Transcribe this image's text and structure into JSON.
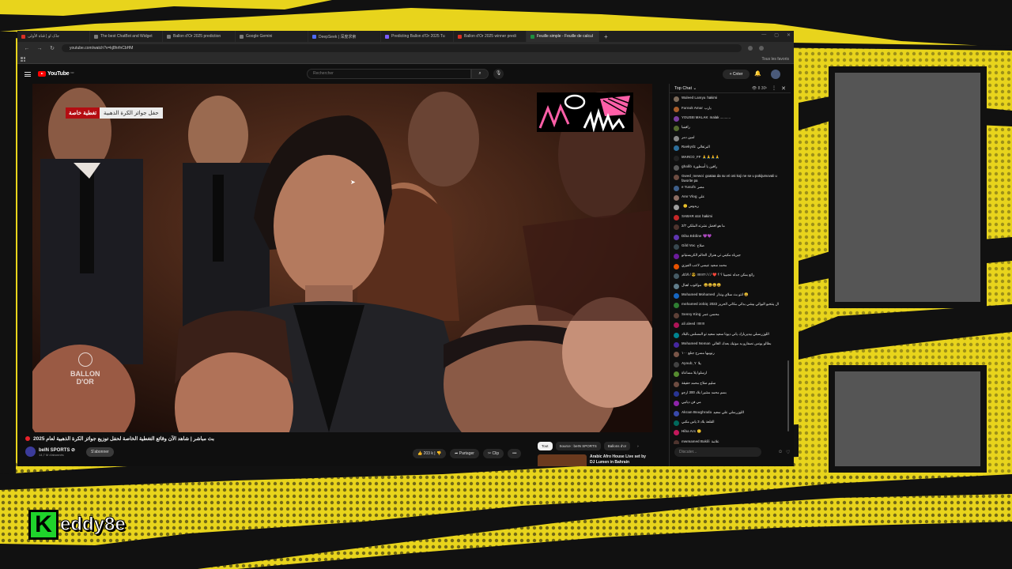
{
  "browser": {
    "tabs": [
      {
        "title": "جاک او | قناة الأولى",
        "color": "#d93025",
        "active": false
      },
      {
        "title": "The best ChatBot and Widget",
        "color": "#7a7a7a",
        "active": false
      },
      {
        "title": "Ballon d'Or 2025 prediction",
        "color": "#7a7a7a",
        "active": false
      },
      {
        "title": "Google Gemini",
        "color": "#7a7a7a",
        "active": false
      },
      {
        "title": "DeepSeek | 深度求索",
        "color": "#4d6bfe",
        "active": false
      },
      {
        "title": "Predicting Ballon d'Or 2025 Tu",
        "color": "#7a5cff",
        "active": false
      },
      {
        "title": "Ballon d'Or 2025 winner predi",
        "color": "#d93025",
        "active": false
      },
      {
        "title": "Feuille simple - Feuille de calcul",
        "color": "#1e8e3e",
        "active": true
      }
    ],
    "new_tab": "+",
    "url": "youtube.com/watch?v=kj8hrfnCbHM",
    "bookmarks_all": "Tous les favoris"
  },
  "youtube": {
    "logo": "YouTube",
    "country": "FR",
    "search_placeholder": "Rechercher",
    "create_label": "Créer"
  },
  "video": {
    "banner_red": "تغطية خاصة",
    "banner_white": "حفل جوائز الكرة الذهبية",
    "watermark": [
      "BALLON",
      "D'OR"
    ],
    "title": "بث مباشر | شاهد الآن وقائع التغطية الخاصة لحفل توزيع جوائز الكرة الذهبية لعام 2025",
    "channel": "beIN SPORTS ⊘",
    "subscribers": "14,7 M d'abonnés",
    "subscribe_label": "S'abonner",
    "likes": "203 k",
    "share_label": "Partager",
    "clip_label": "Clip",
    "more_label": "•••"
  },
  "recommendations": {
    "chips": [
      "Tout",
      "Source : beIN SPORTS",
      "Ballons d'or"
    ],
    "items": [
      {
        "title": "Arabic Afro House Live set by DJ Lumen in Bahrain"
      }
    ]
  },
  "chat": {
    "title": "Top Chat ⌄",
    "viewers": "👁 8 30ᵏ",
    "input_placeholder": "Discuter...",
    "messages": [
      {
        "author": "Waleed Lamya",
        "text": "hakimi",
        "color": "#7d6b5a"
      },
      {
        "author": "Farouk Amar",
        "text": "يارب",
        "color": "#a85d2a"
      },
      {
        "author": "YOUSEI MALAK",
        "text": "malak ...........",
        "color": "#7b3fa0"
      },
      {
        "author": "",
        "text": "رافينيا",
        "color": "#556b2f"
      },
      {
        "author": "",
        "text": "لمين دمر",
        "color": "#888888"
      },
      {
        "author": "Raekydz",
        "text": "البرتغالي",
        "color": "#2c6e9b"
      },
      {
        "author": "MARCO_FF",
        "text": "🙏🙏🙏🙏",
        "color": "#222222"
      },
      {
        "author": "ghalib",
        "text": "رافين يا أسطورة",
        "color": "#5a5a5a"
      },
      {
        "author": "Gwed_mewoi",
        "text": "goataa da su vri oni koji ne se u pokijumovali u favorite pa",
        "color": "#6d4c41"
      },
      {
        "author": "e Yusufs",
        "text": "مصر",
        "color": "#3e5f8a"
      },
      {
        "author": "Amr Vlog",
        "text": "علي",
        "color": "#8d6e63"
      },
      {
        "author": "",
        "text": "🙂 ريدوس",
        "color": "#9e9e9e"
      },
      {
        "author": "SABAR 444",
        "text": "hakimi",
        "color": "#c62828"
      },
      {
        "author": "",
        "text": "ما هو افضل نشرته الملكي 2/7",
        "color": "#4e342e"
      },
      {
        "author": "Diba Eddine",
        "text": "💜💜",
        "color": "#5e35b1"
      },
      {
        "author": "Gild Voc",
        "text": "صلاح",
        "color": "#37474f"
      },
      {
        "author": "",
        "text": "جيرياه مكيني تي هنرال الحالم الكريستيانو",
        "color": "#6a1b9a"
      },
      {
        "author": "",
        "text": "محمد سعيد عيسى لاعب الفيزي",
        "color": "#e65100"
      },
      {
        "author": "",
        "text": "رائع بمكن جداه عجبيبا ؟ ؟ ❤️ / / / ?!!!!!!! 😎 / الاكاد",
        "color": "#455a64"
      },
      {
        "author": "",
        "text": "موكتوب اهبال 😀😀😀😀",
        "color": "#607d8b"
      },
      {
        "author": "Mohamed Mohamed",
        "text": "انتو بث سلاي ونذار 😀",
        "color": "#1565c0"
      },
      {
        "author": "mohamed zobiq",
        "text": "ال ينتخبو البوائي بيشي بدائي مكاني الحريز 2022",
        "color": "#2e7d32"
      },
      {
        "author": "Sonny King",
        "text": "محسن عمر",
        "color": "#5d4037"
      },
      {
        "author": "ali aleed",
        "text": "!!!!!!!!",
        "color": "#ad1457"
      },
      {
        "author": "",
        "text": "اللوزرسبلي بيديربارك ياتي ديونا سعيد سعيد تو المسلس بالبلاد",
        "color": "#00838f"
      },
      {
        "author": "Mohamed Noman",
        "text": "بطالو يونس نصفارو يد موتيك بعدك الغالي",
        "color": "#4527a0"
      },
      {
        "author": "",
        "text": "رنوبيها مسرح جنلع ١٠٠",
        "color": "#795548"
      },
      {
        "author": "Ayoub_Y",
        "text": "يلا",
        "color": "#424242"
      },
      {
        "author": "",
        "text": "ارسلوا يلا مساعاة",
        "color": "#558b2f"
      },
      {
        "author": "",
        "text": "سليم صلاح محمد حقيقة",
        "color": "#6d4c41"
      },
      {
        "author": "",
        "text": "بسم محمد مشيرا بلاد 300 ارجو",
        "color": "#283593"
      },
      {
        "author": "",
        "text": "مي فن ديانيي",
        "color": "#8e24aa"
      },
      {
        "author": "Akram Boughrada",
        "text": "اللوزرسلي علي سعيد",
        "color": "#3949ab"
      },
      {
        "author": "",
        "text": "القلعة بلاد 3 ياس مكبي",
        "color": "#00695c"
      },
      {
        "author": "Hiba Ars",
        "text": "🙂",
        "color": "#c2185b"
      },
      {
        "author": "mwmamed Bakili",
        "text": "علامة",
        "color": "#4e342e"
      },
      {
        "author": "",
        "text": "مدين بيال اكور 😎",
        "color": "#616161"
      },
      {
        "author": "sima_r",
        "text": "ماقلعالعالم",
        "color": "#9e9d24"
      }
    ]
  },
  "overlay": {
    "brand_letter": "K",
    "brand_text": "eddy8e"
  }
}
